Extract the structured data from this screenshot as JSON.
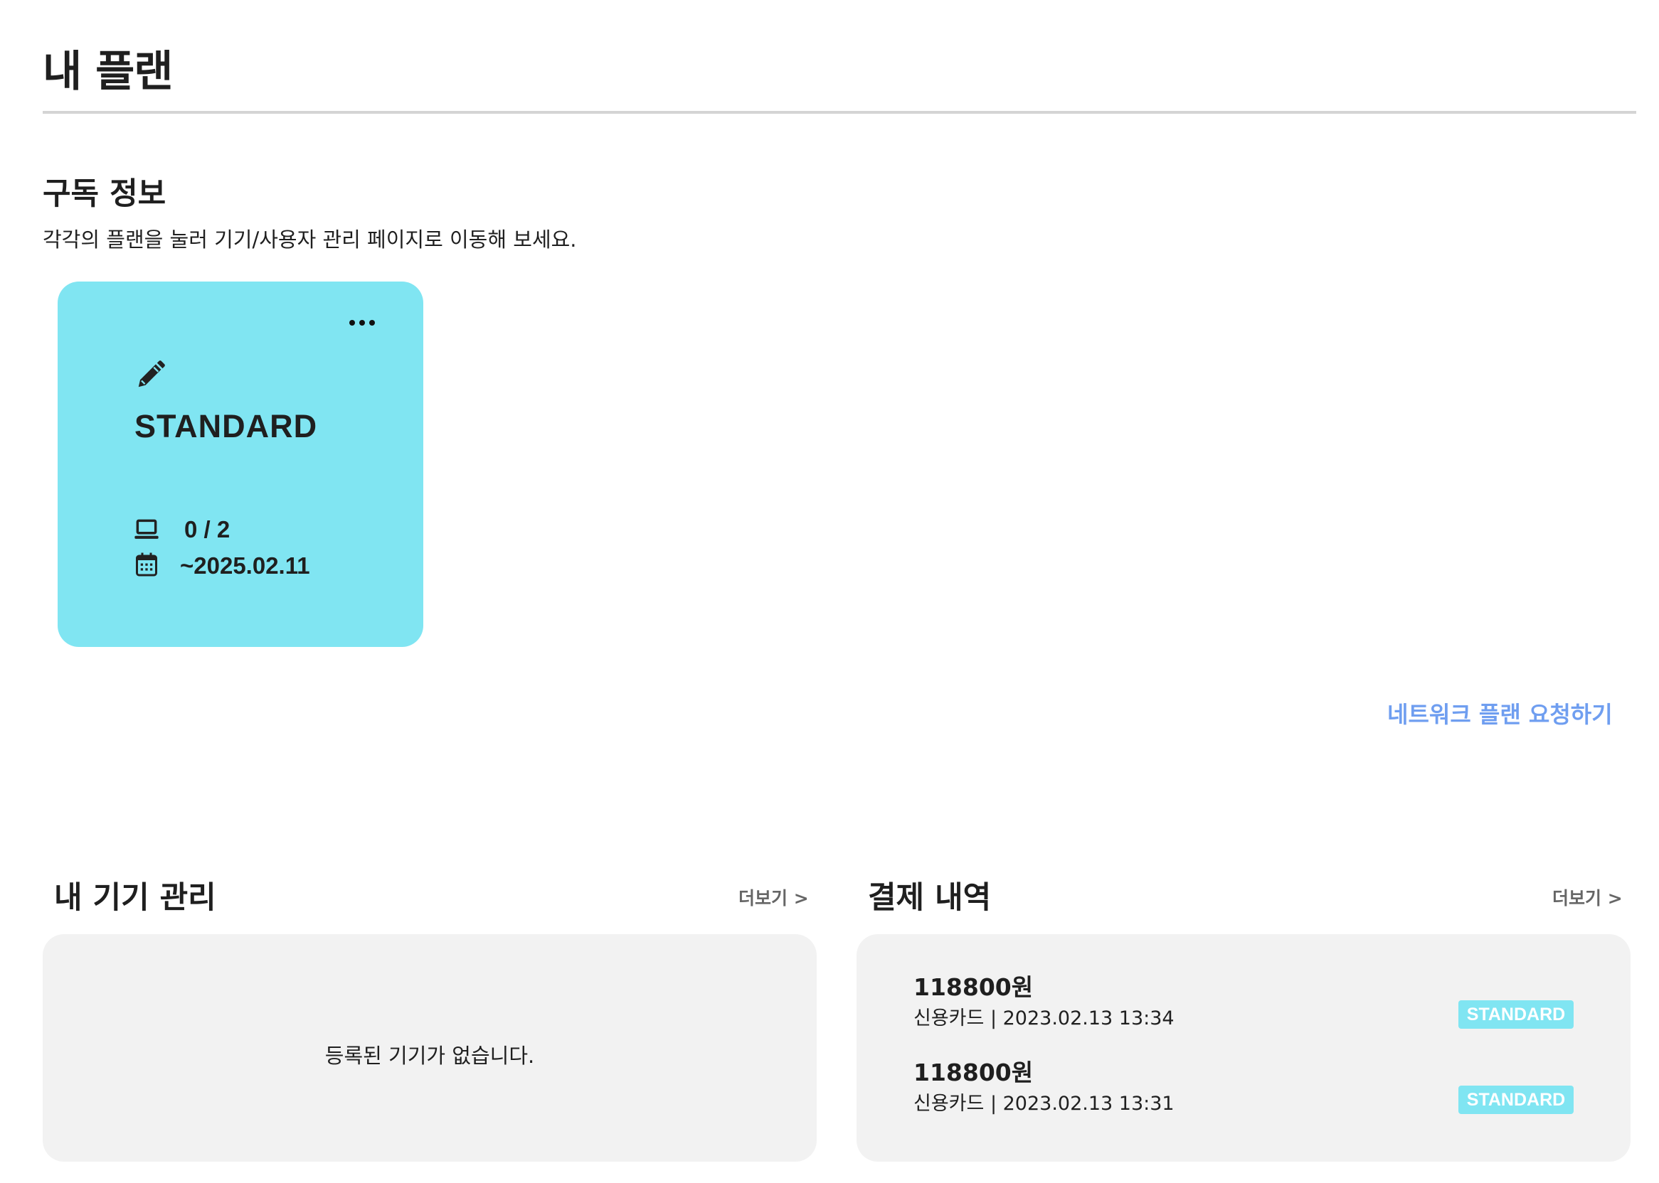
{
  "page": {
    "title": "내 플랜"
  },
  "subscription": {
    "title": "구독 정보",
    "description": "각각의 플랜을 눌러 기기/사용자 관리 페이지로 이동해 보세요.",
    "plan_card": {
      "name": "STANDARD",
      "devices": "0 / 2",
      "expiry": "~2025.02.11",
      "color": "#80e5f2",
      "icons": {
        "edit": "pencil-icon",
        "more": "more-dots-icon",
        "devices": "laptop-icon",
        "expiry": "calendar-icon"
      }
    },
    "request_link": "네트워크 플랜 요청하기"
  },
  "devices_panel": {
    "title": "내 기기 관리",
    "more_label": "더보기 >",
    "empty_message": "등록된 기기가 없습니다."
  },
  "payments_panel": {
    "title": "결제 내역",
    "more_label": "더보기 >",
    "items": [
      {
        "amount": "118800원",
        "meta": "신용카드 | 2023.02.13 13:34",
        "badge": "STANDARD"
      },
      {
        "amount": "118800원",
        "meta": "신용카드 | 2023.02.13 13:31",
        "badge": "STANDARD"
      }
    ]
  },
  "colors": {
    "accent": "#80e5f2",
    "link": "#6f9ef0",
    "panel_bg": "#f2f2f2",
    "rule": "#d4d4d4"
  }
}
